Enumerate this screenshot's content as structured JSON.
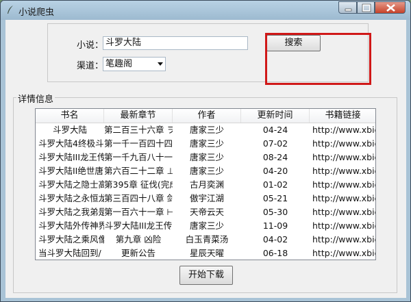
{
  "window": {
    "title": "小说爬虫",
    "controls": [
      "minimize-icon",
      "maximize-icon",
      "close-icon"
    ]
  },
  "form": {
    "novel_label": "小说：",
    "novel_value": "斗罗大陆",
    "channel_label": "渠道：",
    "channel_value": "笔趣阁",
    "search_label": "搜索"
  },
  "details": {
    "group_label": "详情信息",
    "columns": [
      "书名",
      "最新章节",
      "作者",
      "更新时间",
      "书籍链接"
    ],
    "rows": [
      [
        "斗罗大陆",
        "第二百三十六章 ヲ",
        "唐家三少",
        "04-24",
        "http://www.xbiqu"
      ],
      [
        "斗罗大陆4终极斗",
        "第一千一百四十四",
        "唐家三少",
        "07-02",
        "http://www.xbiqu"
      ],
      [
        "斗罗大陆III龙王传",
        "第一千九百八十一",
        "唐家三少",
        "08-24",
        "http://www.xbiqu"
      ],
      [
        "斗罗大陆II绝世唐",
        "第六百二十二章 ⊥",
        "唐家三少",
        "04-20",
        "http://www.xbiqu"
      ],
      [
        "斗罗大陆之隐士高",
        "第395章 征伐(完成",
        "古月奕渊",
        "01-02",
        "http://www.xbiqu"
      ],
      [
        "斗罗大陆之永恒龙",
        "第三百四十八章 剑",
        "傲宇江湖",
        "05-21",
        "http://www.xbiqu"
      ],
      [
        "斗罗大陆之我弟是",
        "第一百六十一章 ⊢",
        "天帝云天",
        "05-30",
        "http://www.xbiqu"
      ],
      [
        "斗罗大陆外传神界",
        "斗罗大陆III龙王传",
        "唐家三少",
        "11-09",
        "http://www.xbiqu"
      ],
      [
        "斗罗大陆之乘风像",
        "第九章 凶险",
        "白玉青菜汤",
        "04-02",
        "http://www.xbiqu"
      ],
      [
        "当斗罗大陆回到/",
        "更新公告",
        "星辰天曜",
        "06-18",
        "http://www.xbiqu"
      ]
    ]
  },
  "download_label": "开始下载",
  "colors": {
    "highlight": "#d01818"
  }
}
